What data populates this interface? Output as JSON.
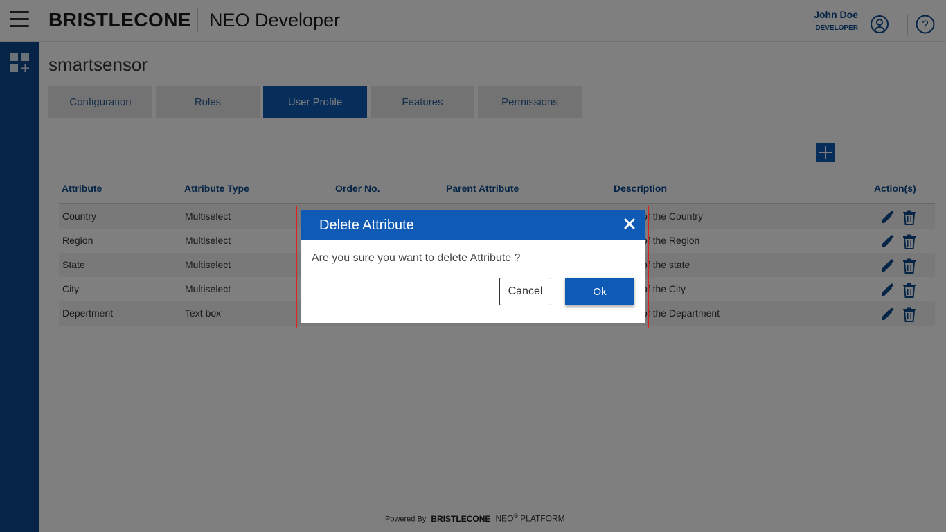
{
  "header": {
    "logo_text": "BRISTLECONE",
    "app_title": "NEO Developer",
    "user_name": "John Doe",
    "user_role": "DEVELOPER"
  },
  "page": {
    "title": "smartsensor"
  },
  "tabs": [
    {
      "label": "Configuration"
    },
    {
      "label": "Roles"
    },
    {
      "label": "User Profile",
      "active": true
    },
    {
      "label": "Features"
    },
    {
      "label": "Permissions"
    }
  ],
  "table": {
    "columns": [
      "Attribute",
      "Attribute Type",
      "Order No.",
      "Parent Attribute",
      "Description",
      "Action(s)"
    ],
    "rows": [
      {
        "attribute": "Country",
        "type": "Multiselect",
        "description": "of the Country"
      },
      {
        "attribute": "Region",
        "type": "Multiselect",
        "description": "of the Region"
      },
      {
        "attribute": "State",
        "type": "Multiselect",
        "description": "of the state"
      },
      {
        "attribute": "City",
        "type": "Multiselect",
        "description": "of the City"
      },
      {
        "attribute": "Depertment",
        "type": "Text box",
        "description": "of the Department"
      }
    ]
  },
  "footer": {
    "powered_by": "Powered By",
    "brand": "BRISTLECONE",
    "neo": "NEO",
    "registered": "®",
    "platform": "PLATFORM"
  },
  "modal": {
    "title": "Delete Attribute",
    "message": "Are you sure you want to delete Attribute ?",
    "cancel_label": "Cancel",
    "ok_label": "Ok"
  },
  "colors": {
    "brand_blue": "#0e5ab5",
    "sidebar_blue": "#0d4a8c",
    "highlight_red": "#e02020"
  }
}
